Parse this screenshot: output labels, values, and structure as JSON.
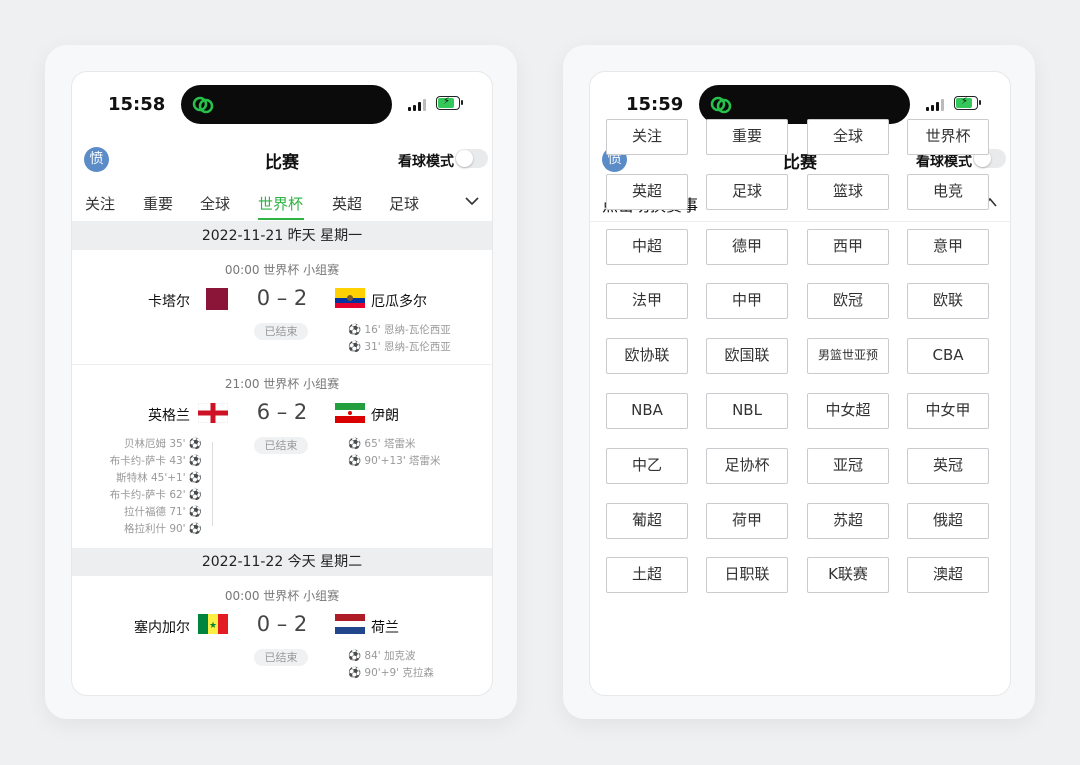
{
  "left": {
    "status": {
      "time": "15:58"
    },
    "header": {
      "avatar": "愤",
      "title": "比赛",
      "mode_label": "看球模式"
    },
    "tabs": [
      "关注",
      "重要",
      "全球",
      "世界杯",
      "英超",
      "足球"
    ],
    "active_tab": "世界杯",
    "sections": [
      {
        "date": "2022-11-21 昨天 星期一"
      },
      {
        "date": "2022-11-22 今天 星期二"
      }
    ],
    "matches": [
      {
        "meta": "00:00 世界杯 小组赛",
        "home": "卡塔尔",
        "away": "厄瓜多尔",
        "score": "0 – 2",
        "status": "已结束",
        "home_events": [],
        "away_events": [
          "16' 恩纳-瓦伦西亚",
          "31' 恩纳-瓦伦西亚"
        ]
      },
      {
        "meta": "21:00 世界杯 小组赛",
        "home": "英格兰",
        "away": "伊朗",
        "score": "6 – 2",
        "status": "已结束",
        "home_events": [
          "贝林厄姆 35'",
          "布卡约-萨卡 43'",
          "斯特林 45'+1'",
          "布卡约-萨卡 62'",
          "拉什福德 71'",
          "格拉利什 90'"
        ],
        "away_events": [
          "65' 塔雷米",
          "90'+13' 塔雷米"
        ]
      },
      {
        "meta": "00:00 世界杯 小组赛",
        "home": "塞内加尔",
        "away": "荷兰",
        "score": "0 – 2",
        "status": "已结束",
        "home_events": [],
        "away_events": [
          "84' 加克波",
          "90'+9' 克拉森"
        ]
      }
    ]
  },
  "right": {
    "status": {
      "time": "15:59"
    },
    "header": {
      "avatar": "愤",
      "title": "比赛",
      "mode_label": "看球模式"
    },
    "switch_label": "点击切换赛事",
    "competitions": [
      "关注",
      "重要",
      "全球",
      "世界杯",
      "英超",
      "足球",
      "篮球",
      "电竞",
      "中超",
      "德甲",
      "西甲",
      "意甲",
      "法甲",
      "中甲",
      "欧冠",
      "欧联",
      "欧协联",
      "欧国联",
      "男篮世亚预",
      "CBA",
      "NBA",
      "NBL",
      "中女超",
      "中女甲",
      "中乙",
      "足协杯",
      "亚冠",
      "英冠",
      "葡超",
      "荷甲",
      "苏超",
      "俄超",
      "土超",
      "日职联",
      "K联赛",
      "澳超"
    ]
  },
  "colors": {
    "accent": "#2fb344",
    "avatar": "#5b8cc8",
    "page_bg": "#eef0f2"
  },
  "icons": {
    "island_logo": "chat-bubbles-icon",
    "more": "chevron-down-icon",
    "collapse": "chevron-up-icon"
  }
}
